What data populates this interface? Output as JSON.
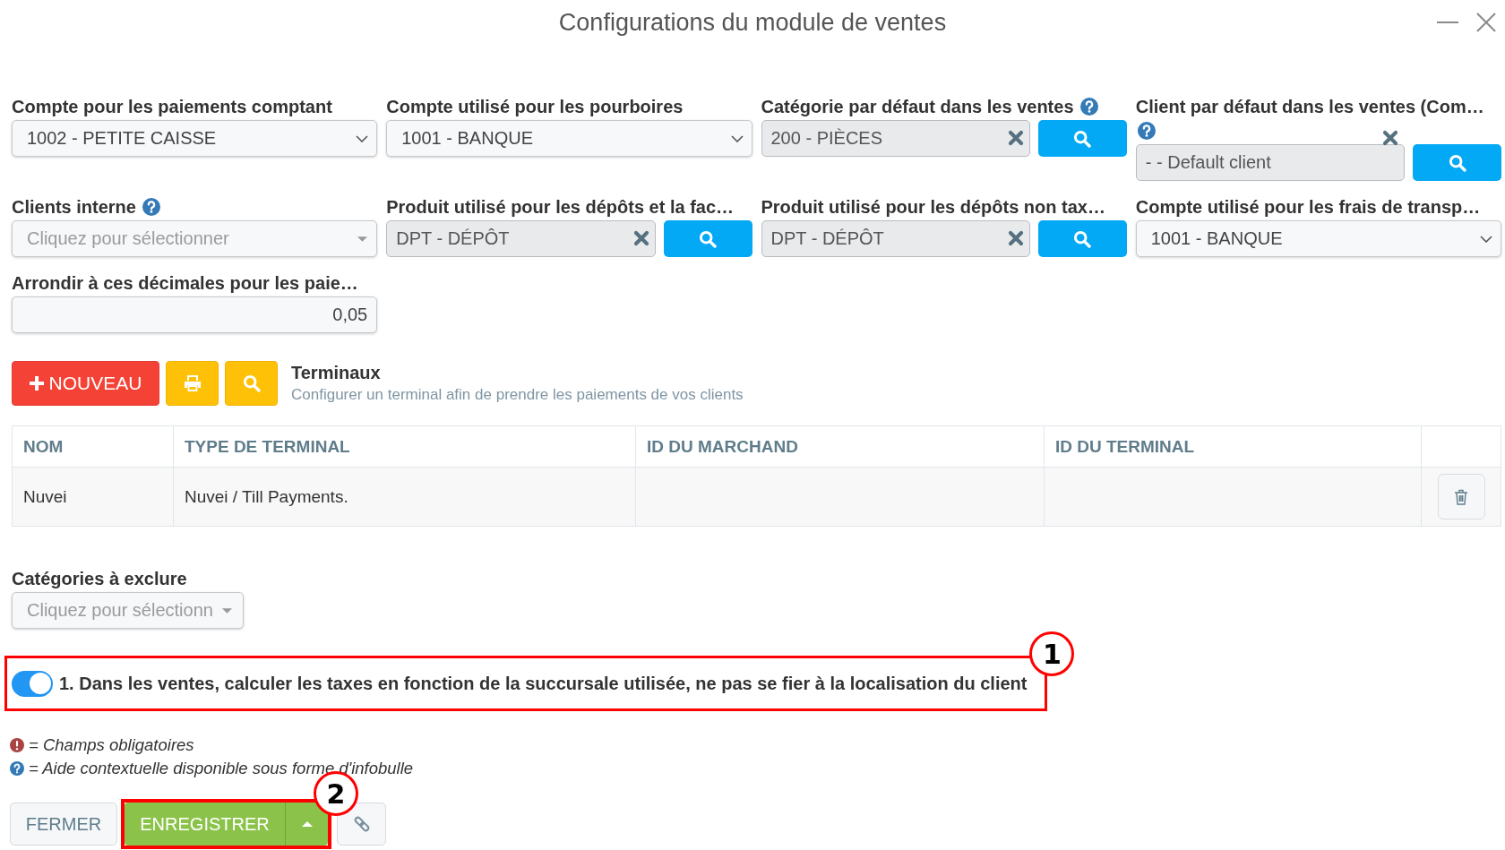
{
  "window": {
    "title": "Configurations du module de ventes"
  },
  "fields": [
    {
      "kind": "select",
      "label": "Compte pour les paiements comptant",
      "help": false,
      "value": "1002 - PETITE CAISSE"
    },
    {
      "kind": "select",
      "label": "Compte utilisé pour les pourboires",
      "help": false,
      "value": "1001 - BANQUE"
    },
    {
      "kind": "lookup",
      "label": "Catégorie par défaut dans les ventes",
      "help": true,
      "value": "200 - PIÈCES"
    },
    {
      "kind": "lookup",
      "label": "Client par défaut dans les ventes (Com…",
      "help": true,
      "value": "- - Default client"
    },
    {
      "kind": "picker",
      "label": "Clients interne",
      "help": true,
      "placeholder": "Cliquez pour sélectionner"
    },
    {
      "kind": "lookup",
      "label": "Produit utilisé pour les dépôts et la fac…",
      "help": false,
      "value": "DPT - DÉPÔT"
    },
    {
      "kind": "lookup",
      "label": "Produit utilisé pour les dépôts non tax…",
      "help": false,
      "value": "DPT - DÉPÔT"
    },
    {
      "kind": "select",
      "label": "Compte utilisé pour les frais de transp…",
      "help": false,
      "value": "1001 - BANQUE"
    },
    {
      "kind": "number",
      "label": "Arrondir à ces décimales pour les paie…",
      "help": false,
      "value": "0,05"
    }
  ],
  "terminals": {
    "toolbar": [
      {
        "kind": "new",
        "label": "NOUVEAU"
      },
      {
        "kind": "print"
      },
      {
        "kind": "search"
      }
    ],
    "title": "Terminaux",
    "subtitle": "Configurer un terminal afin de prendre les paiements de vos clients",
    "columns": [
      "NOM",
      "TYPE DE TERMINAL",
      "ID DU MARCHAND",
      "ID DU TERMINAL"
    ],
    "rows": [
      {
        "cells": [
          "Nuvei",
          "Nuvei / Till Payments."
        ]
      }
    ]
  },
  "excluded_categories": {
    "label": "Catégories à exclure",
    "placeholder": "Cliquez pour sélectionn"
  },
  "tax_option": {
    "label": "1. Dans les ventes, calculer les taxes en fonction de la succursale utilisée, ne pas se fier à la localisation du client",
    "on": true,
    "annotation": "1"
  },
  "legend": [
    {
      "kind": "required",
      "text": "= Champs obligatoires"
    },
    {
      "kind": "help",
      "text": "= Aide contextuelle disponible sous forme d'infobulle"
    }
  ],
  "footer_buttons": [
    {
      "kind": "close",
      "label": "FERMER"
    },
    {
      "kind": "save",
      "label": "ENREGISTRER",
      "annotation": "2"
    },
    {
      "kind": "link"
    }
  ]
}
